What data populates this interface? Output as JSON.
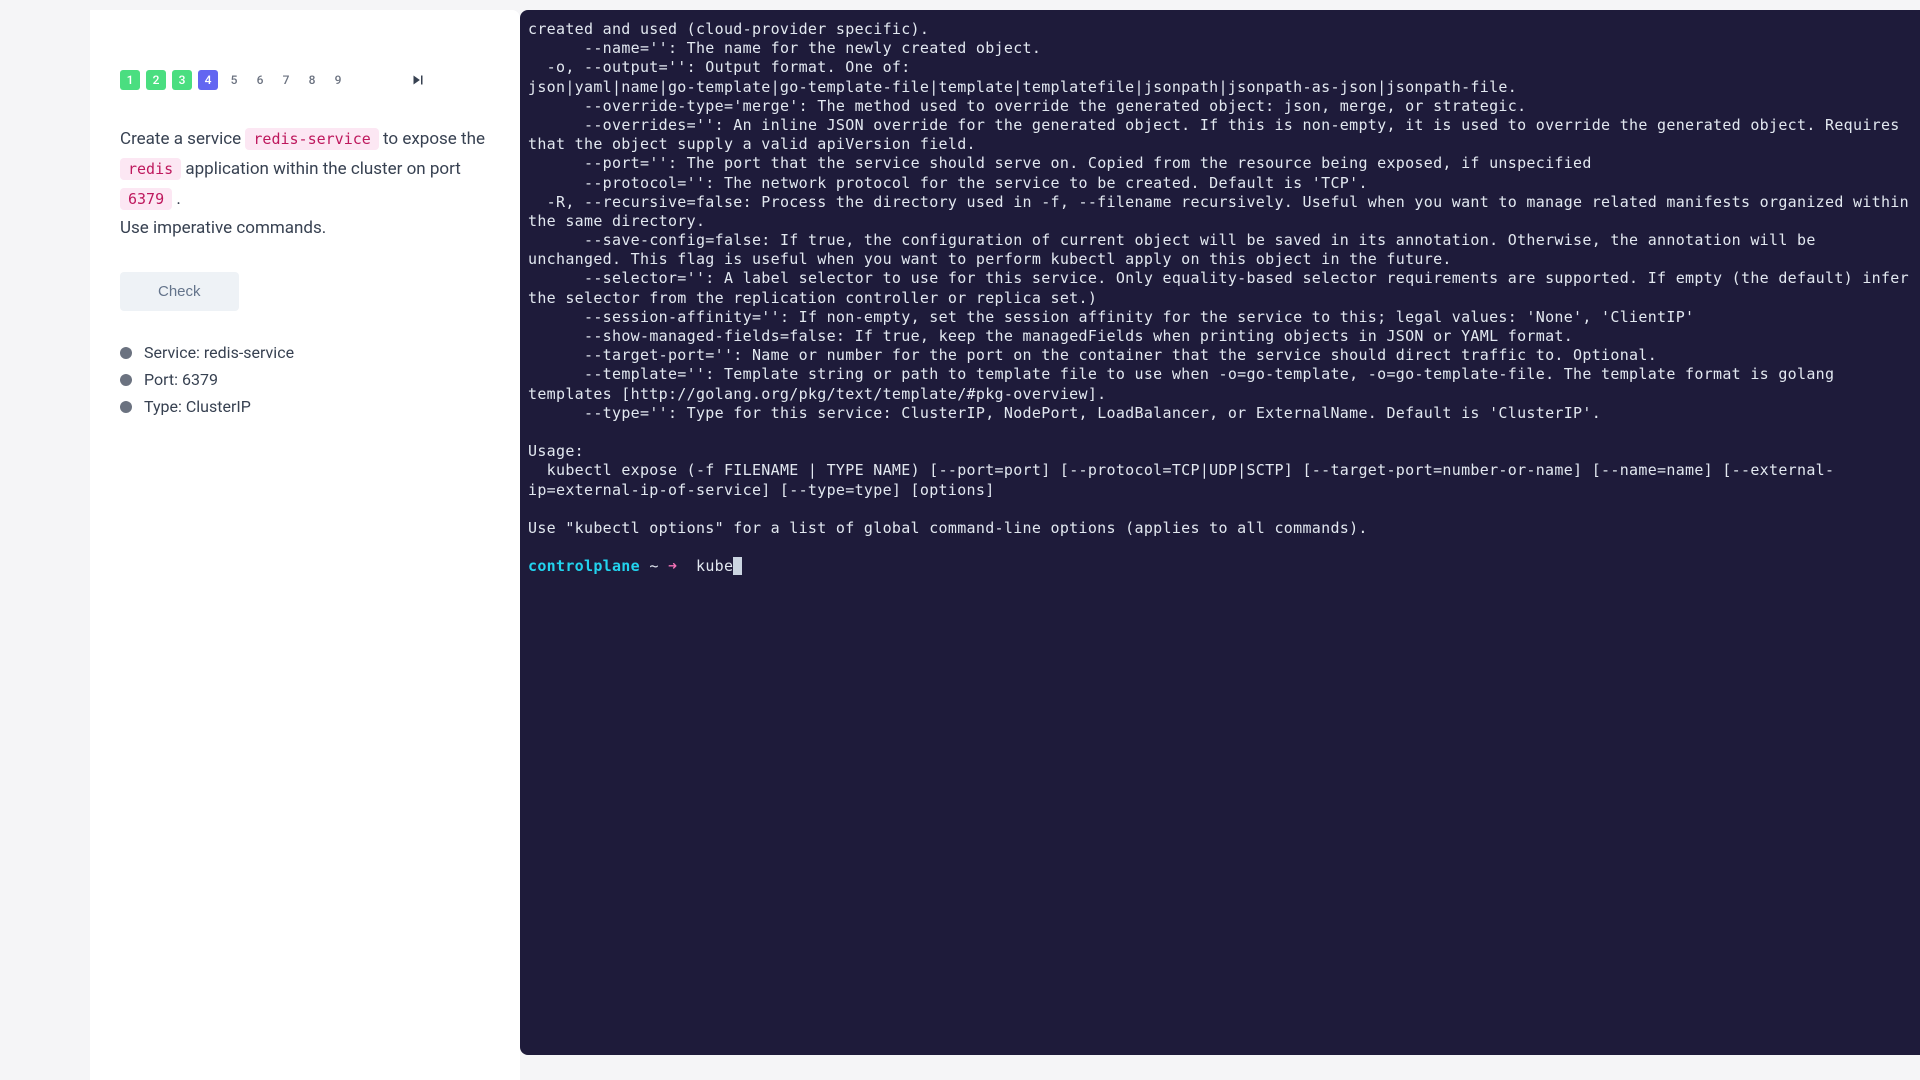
{
  "steps": {
    "items": [
      {
        "n": "1",
        "state": "done"
      },
      {
        "n": "2",
        "state": "done"
      },
      {
        "n": "3",
        "state": "done"
      },
      {
        "n": "4",
        "state": "current"
      },
      {
        "n": "5",
        "state": "pending"
      },
      {
        "n": "6",
        "state": "pending"
      },
      {
        "n": "7",
        "state": "pending"
      },
      {
        "n": "8",
        "state": "pending"
      },
      {
        "n": "9",
        "state": "pending"
      }
    ]
  },
  "instruction": {
    "p1a": "Create a service ",
    "code1": "redis-service",
    "p1b": " to expose the ",
    "code2": "redis",
    "p1c": " application within the cluster on port ",
    "code3": "6379",
    "p1d": " .",
    "p2": "Use imperative commands."
  },
  "check_label": "Check",
  "requirements": [
    "Service: redis-service",
    "Port: 6379",
    "Type: ClusterIP"
  ],
  "terminal": {
    "body": "created and used (cloud-provider specific).\n      --name='': The name for the newly created object.\n  -o, --output='': Output format. One of:\njson|yaml|name|go-template|go-template-file|template|templatefile|jsonpath|jsonpath-as-json|jsonpath-file.\n      --override-type='merge': The method used to override the generated object: json, merge, or strategic.\n      --overrides='': An inline JSON override for the generated object. If this is non-empty, it is used to override the generated object. Requires that the object supply a valid apiVersion field.\n      --port='': The port that the service should serve on. Copied from the resource being exposed, if unspecified\n      --protocol='': The network protocol for the service to be created. Default is 'TCP'.\n  -R, --recursive=false: Process the directory used in -f, --filename recursively. Useful when you want to manage related manifests organized within the same directory.\n      --save-config=false: If true, the configuration of current object will be saved in its annotation. Otherwise, the annotation will be unchanged. This flag is useful when you want to perform kubectl apply on this object in the future.\n      --selector='': A label selector to use for this service. Only equality-based selector requirements are supported. If empty (the default) infer the selector from the replication controller or replica set.)\n      --session-affinity='': If non-empty, set the session affinity for the service to this; legal values: 'None', 'ClientIP'\n      --show-managed-fields=false: If true, keep the managedFields when printing objects in JSON or YAML format.\n      --target-port='': Name or number for the port on the container that the service should direct traffic to. Optional.\n      --template='': Template string or path to template file to use when -o=go-template, -o=go-template-file. The template format is golang templates [http://golang.org/pkg/text/template/#pkg-overview].\n      --type='': Type for this service: ClusterIP, NodePort, LoadBalancer, or ExternalName. Default is 'ClusterIP'.\n\nUsage:\n  kubectl expose (-f FILENAME | TYPE NAME) [--port=port] [--protocol=TCP|UDP|SCTP] [--target-port=number-or-name] [--name=name] [--external-ip=external-ip-of-service] [--type=type] [options]\n\nUse \"kubectl options\" for a list of global command-line options (applies to all commands).\n",
    "prompt_host": "controlplane",
    "prompt_path": " ~ ",
    "prompt_arrow": "➜",
    "input": "  kube"
  }
}
